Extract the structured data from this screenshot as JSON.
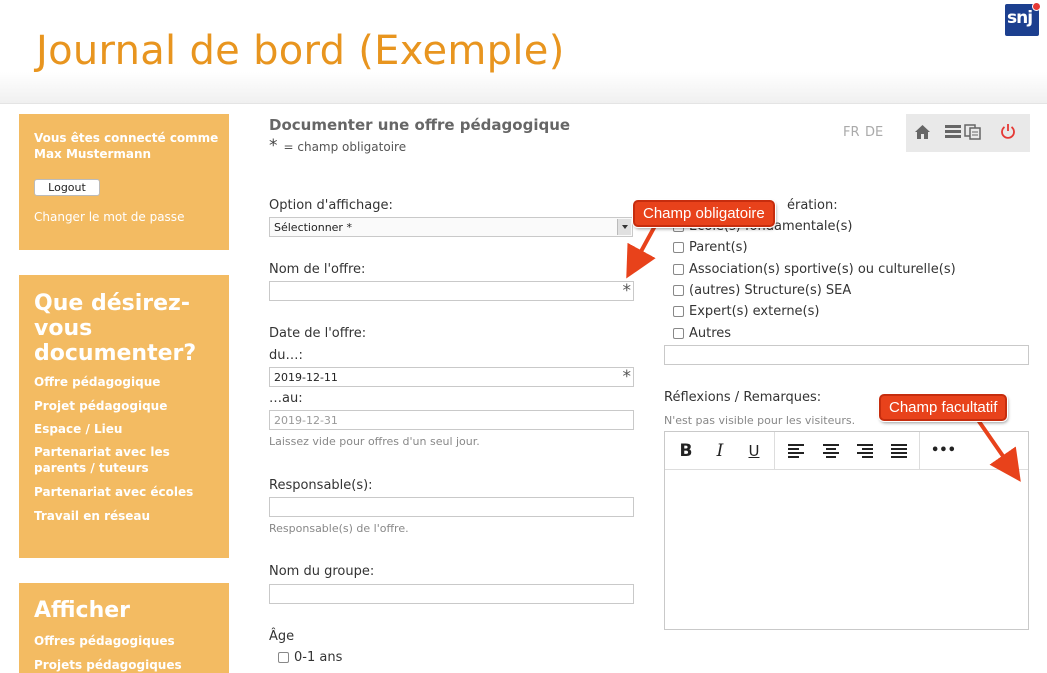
{
  "header": {
    "title": "Journal de bord (Exemple)",
    "logo_text": "snj"
  },
  "session": {
    "connected_line1": "Vous êtes connecté comme",
    "user_name": "Max Mustermann",
    "logout_label": "Logout",
    "change_password": "Changer le mot de passe"
  },
  "document_menu": {
    "heading": "Que désirez-vous documenter?",
    "items": [
      "Offre pédagogique",
      "Projet pédagogique",
      "Espace / Lieu",
      "Partenariat avec les parents / tuteurs",
      "Partenariat avec écoles",
      "Travail en réseau"
    ]
  },
  "display_menu": {
    "heading": "Afficher",
    "items": [
      "Offres pédagogiques",
      "Projets pédagogiques"
    ]
  },
  "page": {
    "title": "Documenter une offre pédagogique",
    "required_note": "= champ obligatoire",
    "required_symbol": "*"
  },
  "languages": [
    "FR",
    "DE"
  ],
  "toolbar": {
    "icons": [
      "home-icon",
      "list-icon",
      "copy-icon",
      "power-icon"
    ]
  },
  "form": {
    "display_option": {
      "label": "Option d'affichage:",
      "value": "Sélectionner *"
    },
    "offer_name": {
      "label": "Nom de l'offre:",
      "value": ""
    },
    "offer_date": {
      "label": "Date de l'offre:",
      "from_label": "du…:",
      "from_value": "2019-12-11",
      "to_label": "…au:",
      "to_placeholder": "2019-12-31",
      "hint": "Laissez vide pour offres d'un seul jour."
    },
    "responsible": {
      "label": "Responsable(s):",
      "hint": "Responsable(s) de l'offre."
    },
    "group_name": {
      "label": "Nom du groupe:"
    },
    "age": {
      "label": "Âge",
      "options": [
        "0-1 ans"
      ]
    },
    "cooperation": {
      "label_visible": "ération:",
      "options": [
        "Ecole(s) fondamentale(s)",
        "Parent(s)",
        "Association(s) sportive(s) ou culturelle(s)",
        "(autres) Structure(s) SEA",
        "Expert(s) externe(s)",
        "Autres"
      ]
    },
    "reflections": {
      "label": "Réflexions / Remarques:",
      "hint": "N'est pas visible pour les visiteurs."
    }
  },
  "editor": {
    "buttons": [
      "B",
      "I",
      "U",
      "align-left",
      "align-center",
      "align-right",
      "justify",
      "•••"
    ]
  },
  "annotations": {
    "required": "Champ obligatoire",
    "optional": "Champ facultatif"
  },
  "colors": {
    "accent": "#e8951f",
    "sidebar": "#f3bb62",
    "callout": "#e8421b",
    "logo": "#1c3f8f"
  }
}
